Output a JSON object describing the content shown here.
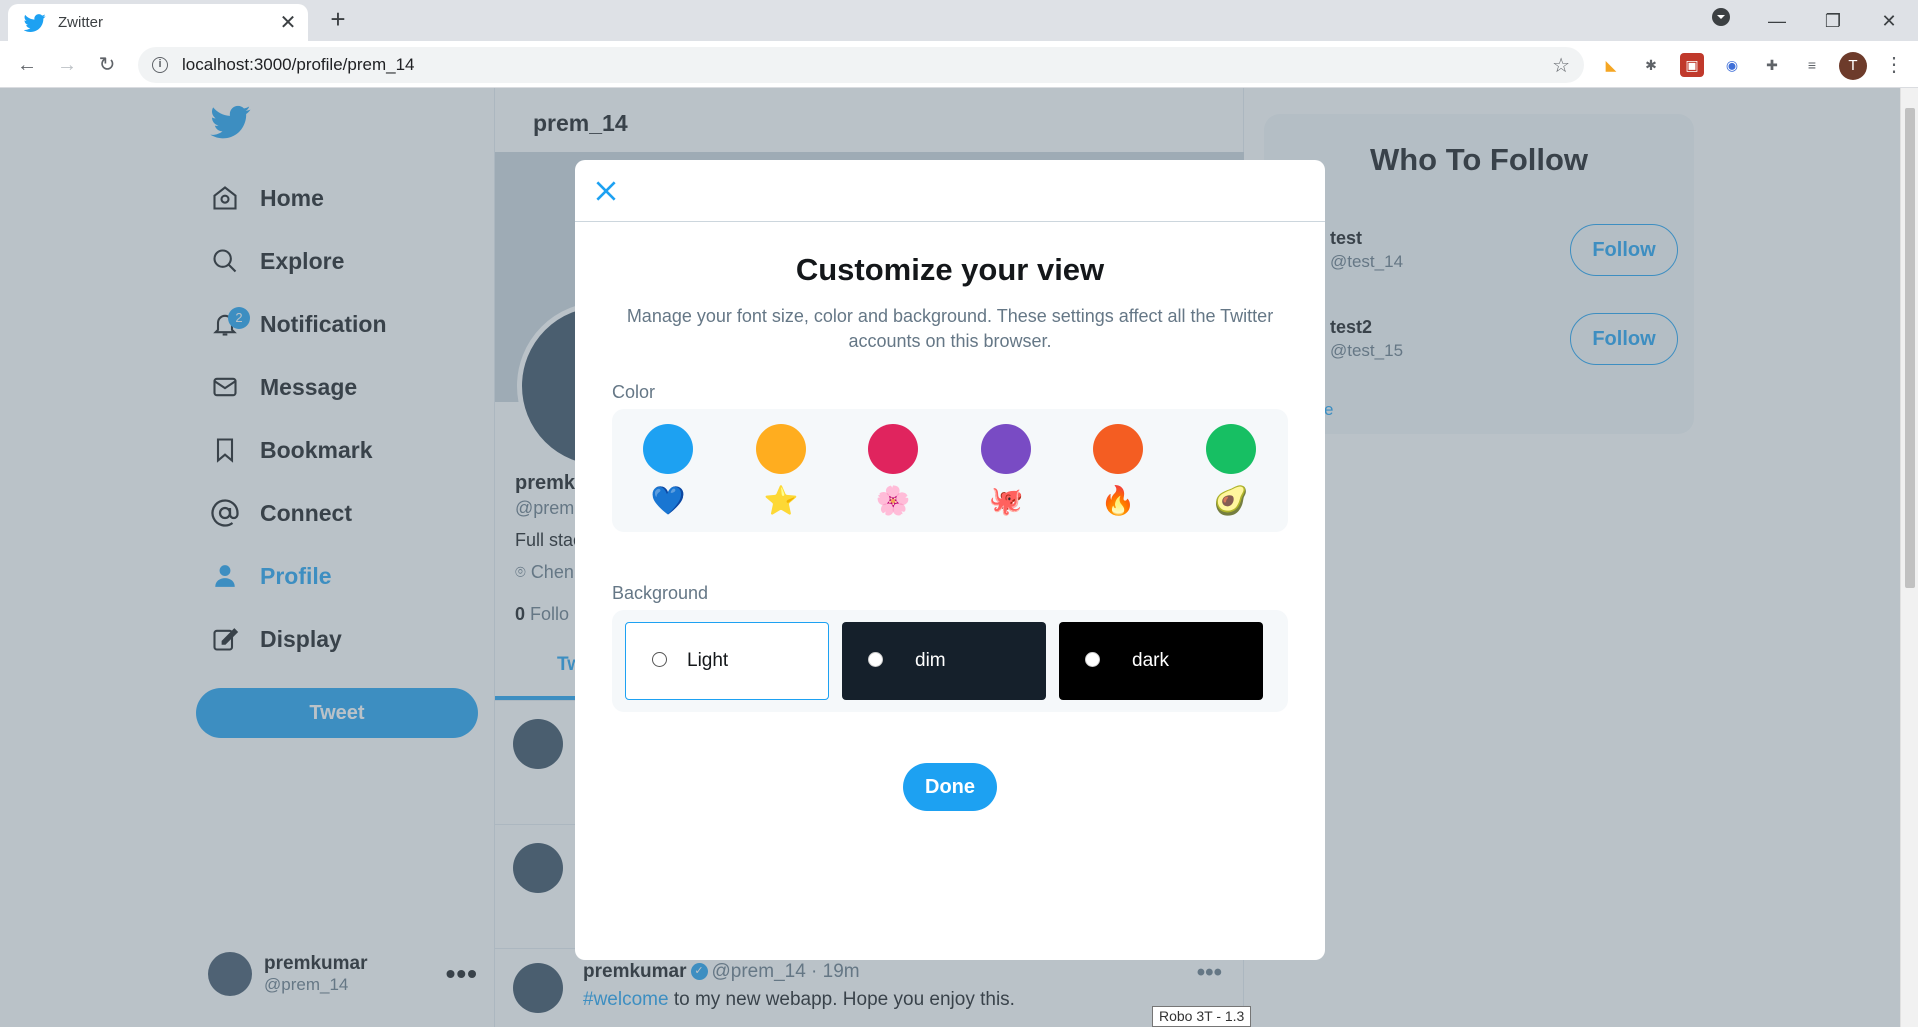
{
  "browser": {
    "tab_title": "Zwitter",
    "url": "localhost:3000/profile/prem_14",
    "profile_initial": "T",
    "tooltip": "Robo 3T - 1.3"
  },
  "sidebar": {
    "items": [
      {
        "label": "Home",
        "icon": "home-icon"
      },
      {
        "label": "Explore",
        "icon": "search-icon"
      },
      {
        "label": "Notification",
        "icon": "bell-icon",
        "badge": "2"
      },
      {
        "label": "Message",
        "icon": "mail-icon"
      },
      {
        "label": "Bookmark",
        "icon": "bookmark-icon"
      },
      {
        "label": "Connect",
        "icon": "at-icon"
      },
      {
        "label": "Profile",
        "icon": "user-icon",
        "active": true
      },
      {
        "label": "Display",
        "icon": "edit-icon"
      }
    ],
    "tweet_button": "Tweet",
    "user": {
      "name": "premkumar",
      "handle": "@prem_14"
    }
  },
  "main": {
    "header": "prem_14",
    "profile_name": "premk",
    "profile_handle": "@prem",
    "bio": "Full stac",
    "location": "Chen",
    "followers_count": "0",
    "followers_label": "Follo",
    "tab": "Tw",
    "last_tweet": {
      "name": "premkumar",
      "handle": "@prem_14",
      "time": "19m",
      "hashtag": "#welcome",
      "text": " to my new webapp. Hope you enjoy this."
    }
  },
  "who_to_follow": {
    "title": "Who To Follow",
    "users": [
      {
        "name": "test",
        "handle": "@test_14",
        "button": "Follow"
      },
      {
        "name": "test2",
        "handle": "@test_15",
        "button": "Follow"
      }
    ],
    "show_more": "e"
  },
  "modal": {
    "title": "Customize your view",
    "description": "Manage your font size, color and background. These settings affect all the Twitter accounts on this browser.",
    "color_label": "Color",
    "colors": [
      {
        "name": "blue",
        "hex": "#1da1f2",
        "emoji": "💙"
      },
      {
        "name": "yellow",
        "hex": "#ffad1f",
        "emoji": "⭐"
      },
      {
        "name": "pink",
        "hex": "#e0245e",
        "emoji": "🌸"
      },
      {
        "name": "purple",
        "hex": "#794bc4",
        "emoji": "🐙"
      },
      {
        "name": "orange",
        "hex": "#f45d22",
        "emoji": "🔥"
      },
      {
        "name": "green",
        "hex": "#17bf63",
        "emoji": "🥑"
      }
    ],
    "background_label": "Background",
    "backgrounds": [
      {
        "label": "Light",
        "selected": false
      },
      {
        "label": "dim",
        "selected": false
      },
      {
        "label": "dark",
        "selected": false
      }
    ],
    "done_button": "Done"
  },
  "colors": {
    "accent": "#1da1f2",
    "dim_bg": "#15202b",
    "dark_bg": "#000000"
  }
}
